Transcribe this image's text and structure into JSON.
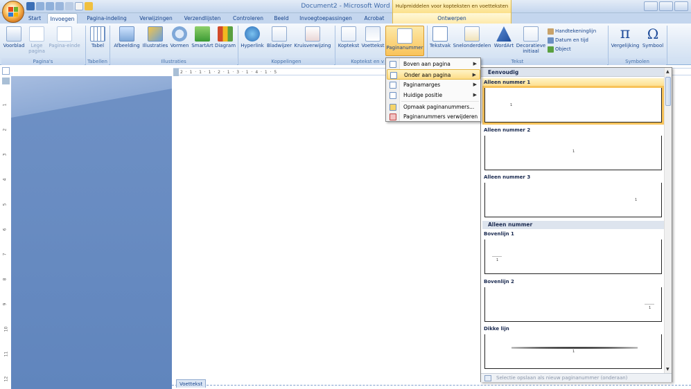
{
  "window": {
    "title": "Document2 - Microsoft Word",
    "context_tab_header": "Hulpmiddelen voor kopteksten en voetteksten"
  },
  "tabs": [
    {
      "label": "Start"
    },
    {
      "label": "Invoegen"
    },
    {
      "label": "Pagina-indeling"
    },
    {
      "label": "Verwijzingen"
    },
    {
      "label": "Verzendlijsten"
    },
    {
      "label": "Controleren"
    },
    {
      "label": "Beeld"
    },
    {
      "label": "Invoegtoepassingen"
    },
    {
      "label": "Acrobat"
    },
    {
      "label": "Ontwerpen"
    }
  ],
  "ribbon": {
    "buttons": {
      "voorblad": "Voorblad",
      "lege_pagina": "Lege pagina",
      "pagina_einde": "Pagina-einde",
      "tabel": "Tabel",
      "afbeelding": "Afbeelding",
      "illustraties": "Illustraties",
      "vormen": "Vormen",
      "smartart": "SmartArt",
      "diagram": "Diagram",
      "hyperlink": "Hyperlink",
      "bladwijzer": "Bladwijzer",
      "kruisverwijzing": "Kruisverwijzing",
      "koptekst": "Koptekst",
      "voettekst": "Voettekst",
      "paginanummer": "Paginanummer",
      "tekstvak": "Tekstvak",
      "snelonderdelen": "Snelonderdelen",
      "wordart": "WordArt",
      "decoratieve_initiaal": "Decoratieve initiaal",
      "handtekeninglijn": "Handtekeninglijn",
      "datum_en_tijd": "Datum en tijd",
      "object": "Object",
      "vergelijking": "Vergelijking",
      "symbool": "Symbool"
    },
    "groups": {
      "paginas": "Pagina's",
      "tabellen": "Tabellen",
      "illustraties": "Illustraties",
      "koppelingen": "Koppelingen",
      "koptekst_en_voettekst": "Koptekst en v",
      "tekst": "Tekst",
      "symbolen": "Symbolen"
    }
  },
  "ruler": {
    "numbers": "2 · 1 · 1 · 1 · 2 · 1 · 3 · 1 · 4 · 1 · 5",
    "vertical": [
      "1",
      "2",
      "3",
      "4",
      "5",
      "6",
      "7",
      "8",
      "9",
      "10",
      "11",
      "12"
    ]
  },
  "document": {
    "footer_tab": "Voettekst"
  },
  "menu": {
    "items": [
      {
        "label": "Boven aan pagina",
        "has_submenu": true
      },
      {
        "label": "Onder aan pagina",
        "has_submenu": true,
        "highlighted": true
      },
      {
        "label": "Paginamarges",
        "has_submenu": true
      },
      {
        "label": "Huidige positie",
        "has_submenu": true
      },
      {
        "label": "Opmaak paginanummers...",
        "has_submenu": false
      },
      {
        "label": "Paginanummers verwijderen",
        "has_submenu": false
      }
    ]
  },
  "gallery": {
    "header": "Eenvoudig",
    "items": [
      {
        "title": "Alleen nummer 1",
        "number": "1"
      },
      {
        "title": "Alleen nummer 2",
        "number": "1"
      },
      {
        "title": "Alleen nummer 3",
        "number": "1"
      }
    ],
    "section2": "Alleen nummer",
    "items2": [
      {
        "title": "Bovenlijn 1",
        "number": "1"
      },
      {
        "title": "Bovenlijn 2",
        "number": "1"
      },
      {
        "title": "Dikke lijn",
        "number": "1"
      }
    ],
    "footer": "Selectie opslaan als nieuw paginanummer (onderaan)"
  },
  "colors": {
    "accent": "#15428b",
    "highlight": "#fddc86",
    "doc_background": "#6085bd"
  }
}
